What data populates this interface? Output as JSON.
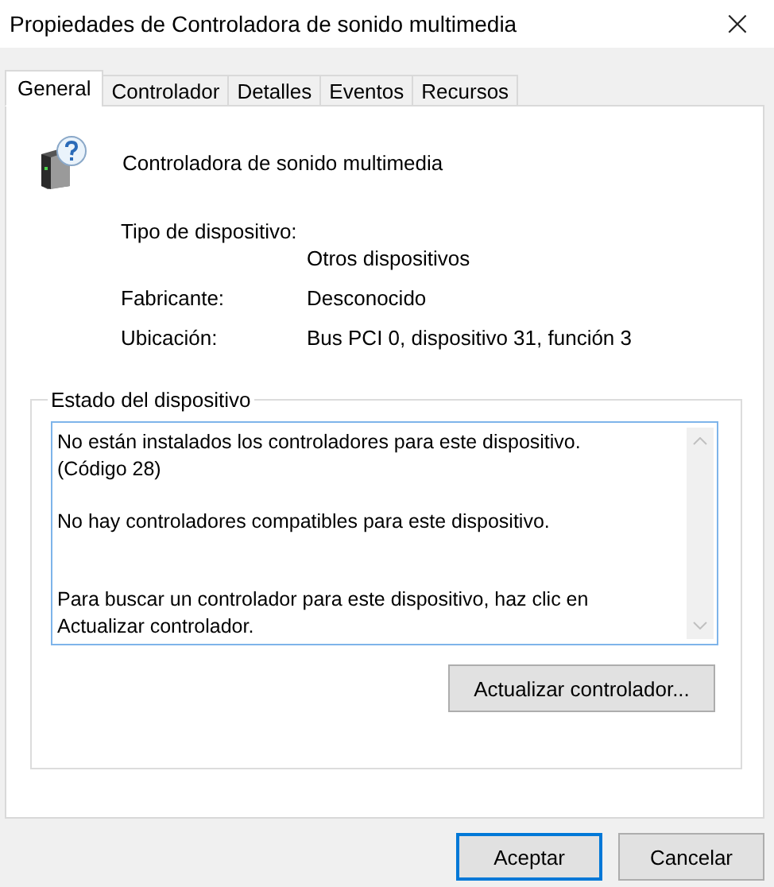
{
  "window": {
    "title": "Propiedades de Controladora de sonido multimedia",
    "close": "×"
  },
  "tabs": [
    {
      "label": "General",
      "selected": true
    },
    {
      "label": "Controlador",
      "selected": false
    },
    {
      "label": "Detalles",
      "selected": false
    },
    {
      "label": "Eventos",
      "selected": false
    },
    {
      "label": "Recursos",
      "selected": false
    }
  ],
  "device": {
    "name": "Controladora de sonido multimedia"
  },
  "properties": [
    {
      "label": "Tipo de dispositivo:",
      "value": "Otros dispositivos",
      "kind": "stacked"
    },
    {
      "label": "Fabricante:",
      "value": "Desconocido",
      "kind": "inline"
    },
    {
      "label": "Ubicación:",
      "value": "Bus PCI 0, dispositivo 31, función 3",
      "kind": "inline"
    }
  ],
  "status": {
    "legend": "Estado del dispositivo",
    "text": "No están instalados los controladores para este dispositivo.\n(Código 28)\n\nNo hay controladores compatibles para este dispositivo.\n\n\nPara buscar un controlador para este dispositivo, haz clic en\nActualizar controlador.",
    "button": "Actualizar controlador..."
  },
  "buttons": [
    {
      "label": "Aceptar",
      "default": true
    },
    {
      "label": "Cancelar",
      "default": false
    }
  ]
}
